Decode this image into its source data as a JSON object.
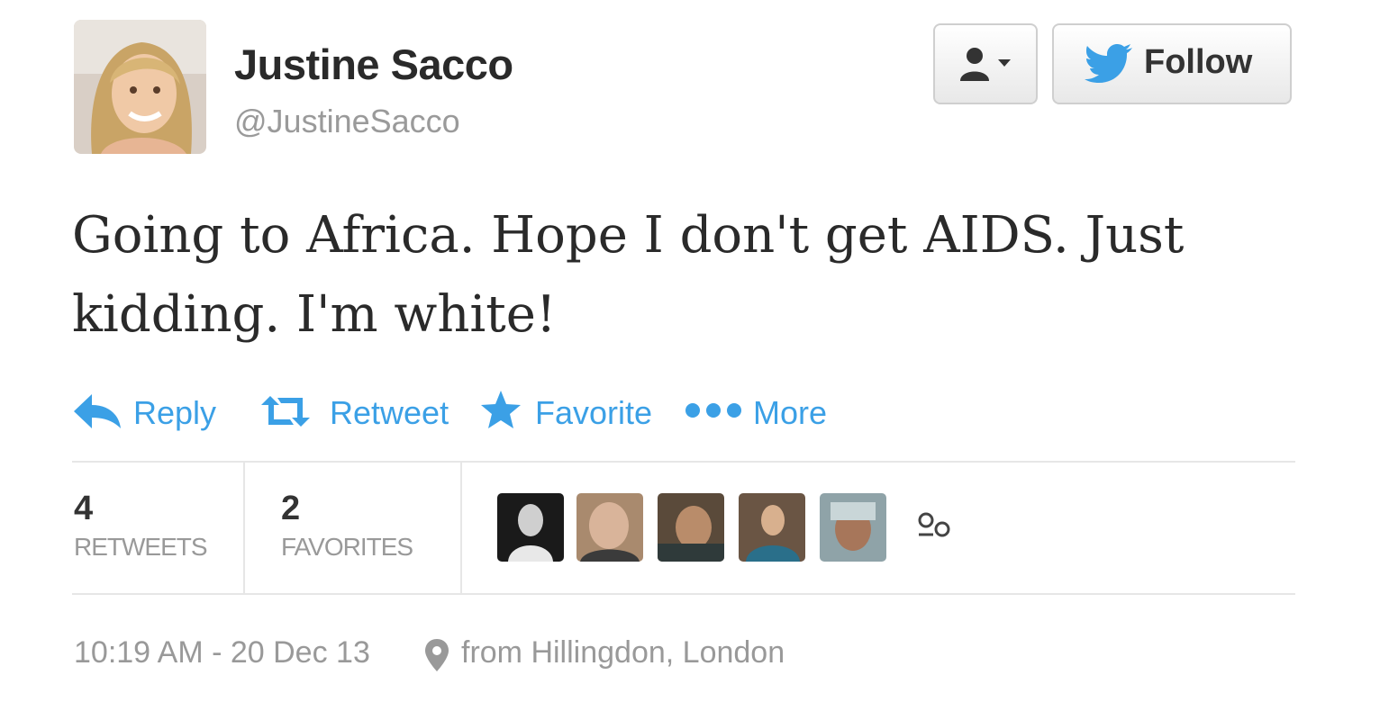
{
  "user": {
    "name": "Justine Sacco",
    "handle": "@JustineSacco"
  },
  "header": {
    "user_menu_icon": "person-dropdown-icon",
    "follow_label": "Follow",
    "follow_icon": "twitter-bird-icon"
  },
  "tweet": {
    "text": "Going to Africa. Hope I don't get AIDS. Just kidding. I'm white!"
  },
  "actions": {
    "reply": "Reply",
    "retweet": "Retweet",
    "favorite": "Favorite",
    "more": "More"
  },
  "stats": {
    "retweets_count": "4",
    "retweets_label": "RETWEETS",
    "favorites_count": "2",
    "favorites_label": "FAVORITES"
  },
  "footer": {
    "timestamp": "10:19 AM - 20 Dec 13",
    "location": "from Hillingdon, London"
  },
  "colors": {
    "link_blue": "#3ba0e6",
    "text_dark": "#2a2a2a",
    "text_muted": "#999999"
  }
}
